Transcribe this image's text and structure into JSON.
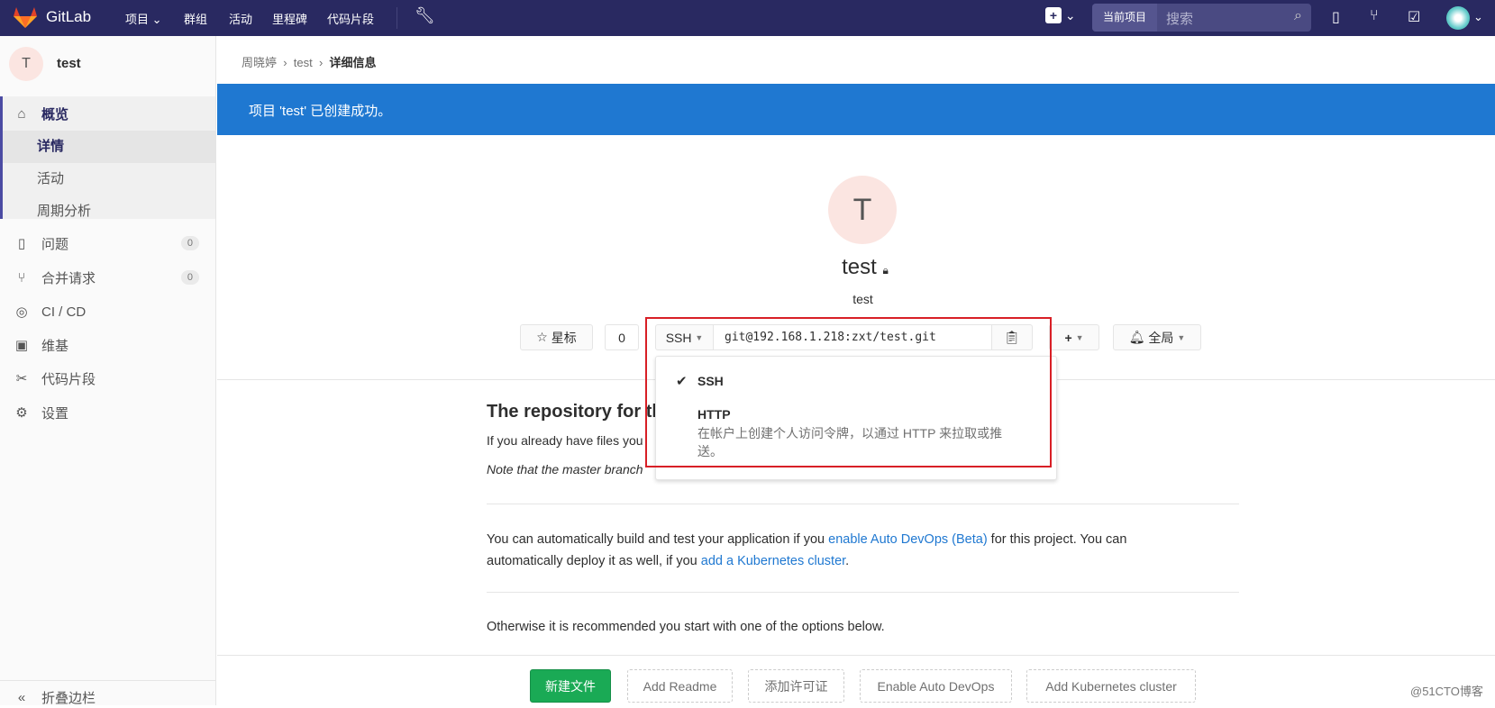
{
  "nav": {
    "brand": "GitLab",
    "items": [
      "项目",
      "群组",
      "活动",
      "里程碑",
      "代码片段"
    ],
    "search_scope": "当前项目",
    "search_placeholder": "搜索"
  },
  "sidebar": {
    "avatar_letter": "T",
    "project": "test",
    "overview": "概览",
    "sub": [
      "详情",
      "活动",
      "周期分析"
    ],
    "items": [
      {
        "label": "问题",
        "count": "0"
      },
      {
        "label": "合并请求",
        "count": "0"
      },
      {
        "label": "CI / CD"
      },
      {
        "label": "维基"
      },
      {
        "label": "代码片段"
      },
      {
        "label": "设置"
      }
    ],
    "collapse": "折叠边栏"
  },
  "breadcrumb": [
    "周晓婷",
    "test",
    "详细信息"
  ],
  "flash": "项目 'test' 已创建成功。",
  "project": {
    "avatar_letter": "T",
    "name": "test",
    "description": "test"
  },
  "actions": {
    "star": "星标",
    "star_count": "0",
    "protocol": "SSH",
    "clone_url": "git@192.168.1.218:zxt/test.git",
    "notify": "全局"
  },
  "dropdown": {
    "ssh": "SSH",
    "http": "HTTP",
    "http_desc": "在帐户上创建个人访问令牌，以通过 HTTP 来拉取或推送。"
  },
  "empty": {
    "heading": "The repository for th",
    "line1": "If you already have files you",
    "line2": "Note that the master branch",
    "p1a": "You can automatically build and test your application if you ",
    "link1": "enable Auto DevOps (Beta)",
    "p1b": " for this project. You can automatically deploy it as well, if you ",
    "link2": "add a Kubernetes cluster",
    "p1c": ".",
    "p2": "Otherwise it is recommended you start with one of the options below."
  },
  "bottom": {
    "new_file": "新建文件",
    "readme": "Add Readme",
    "license": "添加许可证",
    "devops": "Enable Auto DevOps",
    "k8s": "Add Kubernetes cluster"
  },
  "watermark": "@51CTO博客",
  "colors": {
    "nav": "#292961",
    "flash": "#1f78d1",
    "green": "#1aaa55",
    "highlight": "#d81f26"
  }
}
